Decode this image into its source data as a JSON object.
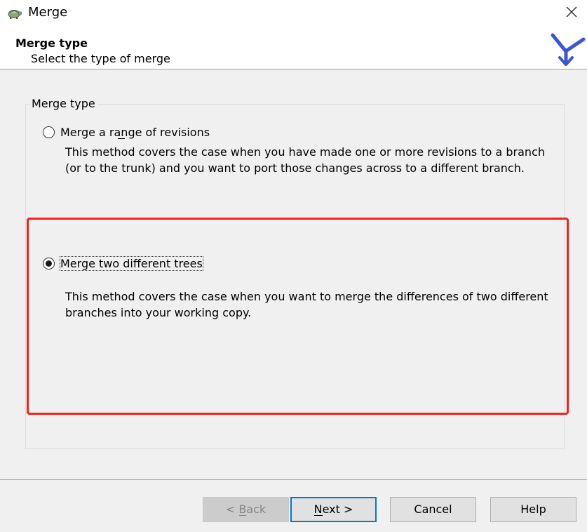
{
  "window": {
    "title": "Merge",
    "app_icon": "tortoise-icon",
    "close_icon": "close-icon"
  },
  "header": {
    "title": "Merge type",
    "subtitle": "Select the type of merge",
    "logo_icon": "merge-branches-icon"
  },
  "group": {
    "legend": "Merge type",
    "options": [
      {
        "label": "Merge a range of revisions",
        "description_lines": [
          "This method covers the case when you have made one or more revisions to a branch",
          "(or to the trunk) and you want to port those changes across to a different branch."
        ],
        "checked": false
      },
      {
        "label": "Merge two different trees",
        "description_lines": [
          "This method covers the case when you want to merge the differences of two different",
          "branches into your working copy."
        ],
        "checked": true
      }
    ]
  },
  "buttons": {
    "back": "< Back",
    "next": "Next >",
    "cancel": "Cancel",
    "help": "Help"
  },
  "colors": {
    "highlight": "#f0231c",
    "default_button_border": "#0078d7",
    "logo": "#3a55d6"
  }
}
